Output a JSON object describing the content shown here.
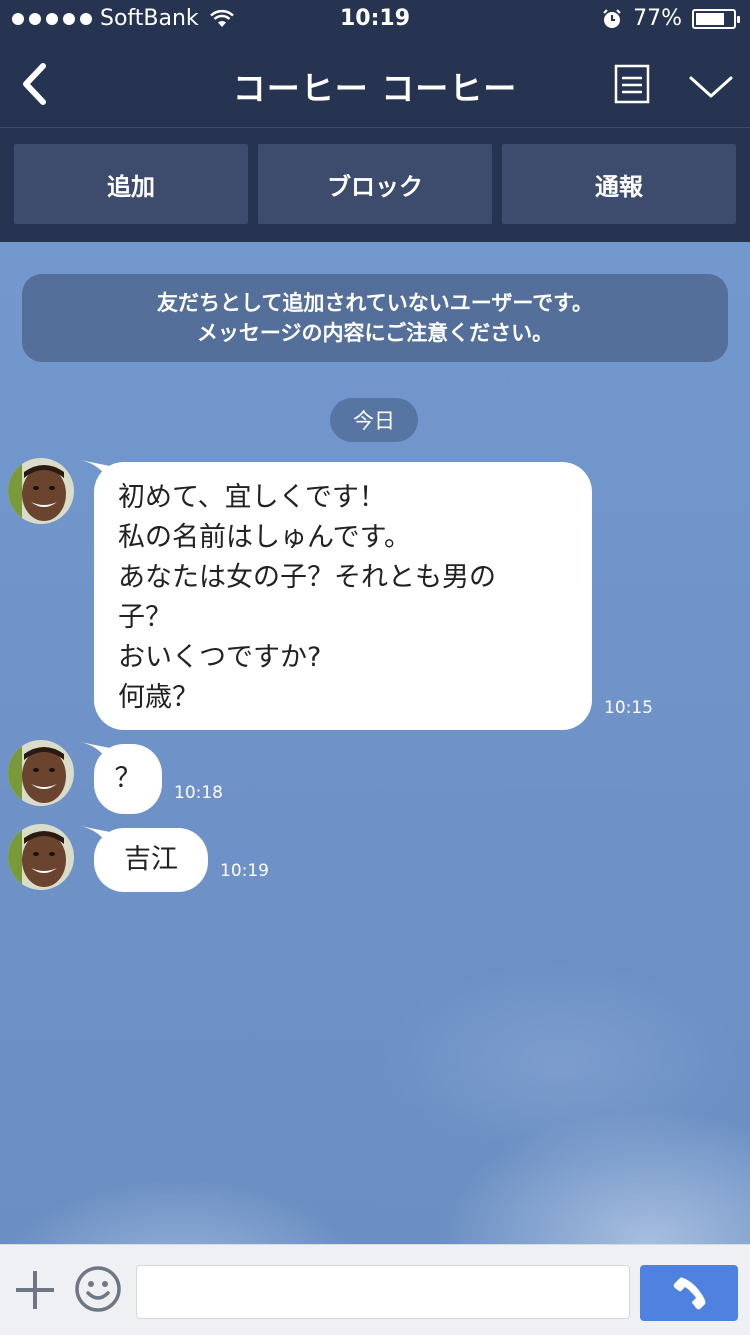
{
  "status_bar": {
    "carrier": "SoftBank",
    "time": "10:19",
    "battery_percent": "77%",
    "battery_level": 0.77
  },
  "header": {
    "title": "コーヒー コーヒー"
  },
  "actions": {
    "add": "追加",
    "block": "ブロック",
    "report": "通報"
  },
  "notice": {
    "line1": "友だちとして追加されていないユーザーです。",
    "line2": "メッセージの内容にご注意ください。"
  },
  "date_label": "今日",
  "messages": [
    {
      "lines": [
        "初めて、宜しくです！",
        "私の名前はしゅんです。",
        "あなたは女の子？それとも男の",
        "子？",
        "おいくつですか?",
        "何歳？"
      ],
      "time": "10:15"
    },
    {
      "lines": [
        "？"
      ],
      "time": "10:18"
    },
    {
      "lines": [
        "吉江"
      ],
      "time": "10:19"
    }
  ],
  "colors": {
    "header_bg": "#263451",
    "action_bg": "#3d4c6c",
    "call_button": "#4f82e0",
    "chat_bg": "#7398ce"
  },
  "icons": [
    "back-icon",
    "menu-icon",
    "chevron-down-icon",
    "plus-icon",
    "emoji-icon",
    "phone-icon",
    "wifi-icon",
    "alarm-icon",
    "battery-icon"
  ]
}
